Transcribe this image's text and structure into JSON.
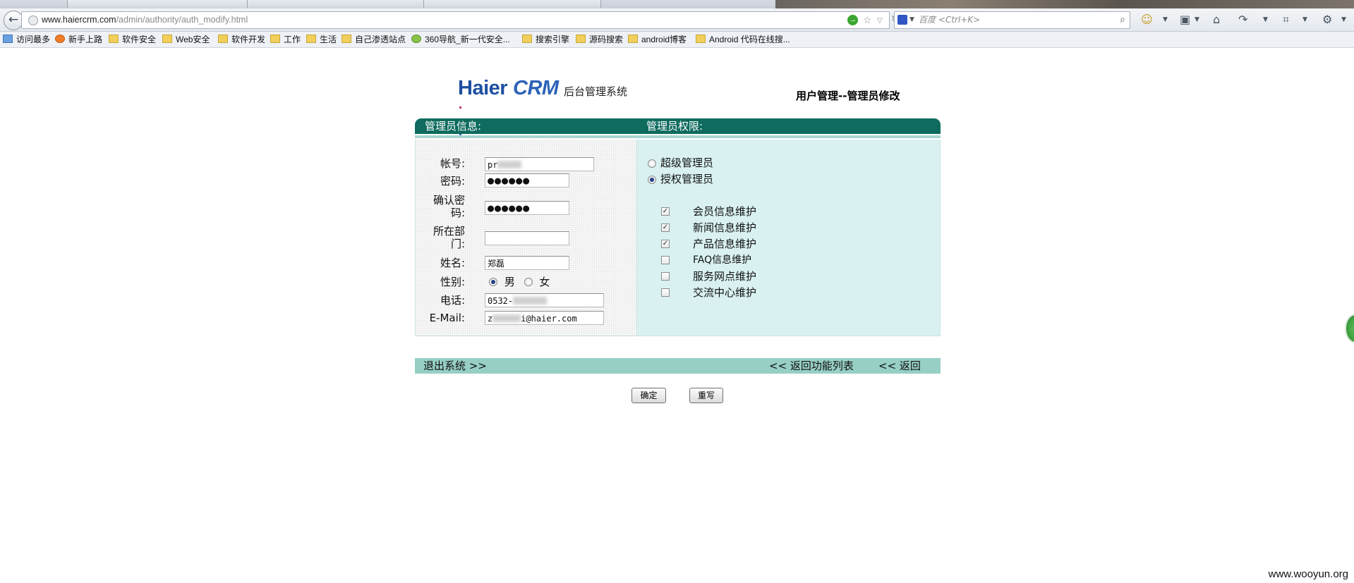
{
  "browser": {
    "url_host": "www.haiercrm.com",
    "url_path": "/admin/authority/auth_modify.html",
    "search_placeholder": "百度 <Ctrl+K>",
    "bookmarks": [
      "访问最多",
      "新手上路",
      "软件安全",
      "Web安全",
      "软件开发",
      "工作",
      "生活",
      "自己渗透站点",
      "360导航_新一代安全...",
      "搜索引擎",
      "源码搜索",
      "android博客",
      "Android 代码在线搜..."
    ]
  },
  "header": {
    "logo_brand": "Haier",
    "logo_product": "CRM",
    "subtitle": "后台管理系统",
    "page_title": "用户管理--管理员修改"
  },
  "panel": {
    "left_title": "管理员信息:",
    "right_title": "管理员权限:"
  },
  "form": {
    "account_label": "帐号:",
    "account_value": "pr",
    "password_label": "密码:",
    "password_value": "●●●●●●",
    "confirm_label": "确认密码:",
    "confirm_value": "●●●●●●",
    "dept_label": "所在部门:",
    "dept_value": "",
    "name_label": "姓名:",
    "name_value": "郑磊",
    "gender_label": "性别:",
    "gender_male": "男",
    "gender_female": "女",
    "gender_selected": "男",
    "phone_label": "电话:",
    "phone_value": "0532-",
    "email_label": "E-Mail:",
    "email_value_prefix": "z",
    "email_value_suffix": "i@haier.com"
  },
  "permissions": {
    "roles": [
      {
        "label": "超级管理员",
        "selected": false
      },
      {
        "label": "授权管理员",
        "selected": true
      }
    ],
    "items": [
      {
        "label": "会员信息维护",
        "checked": true
      },
      {
        "label": "新闻信息维护",
        "checked": true
      },
      {
        "label": "产品信息维护",
        "checked": true
      },
      {
        "label": "FAQ信息维护",
        "checked": false
      },
      {
        "label": "服务网点维护",
        "checked": false
      },
      {
        "label": "交流中心维护",
        "checked": false
      }
    ]
  },
  "footer": {
    "logout": "退出系统 >>",
    "back_to_list": "<< 返回功能列表",
    "back": "<< 返回"
  },
  "buttons": {
    "confirm": "确定",
    "reset": "重写"
  },
  "watermark": "www.wooyun.org"
}
